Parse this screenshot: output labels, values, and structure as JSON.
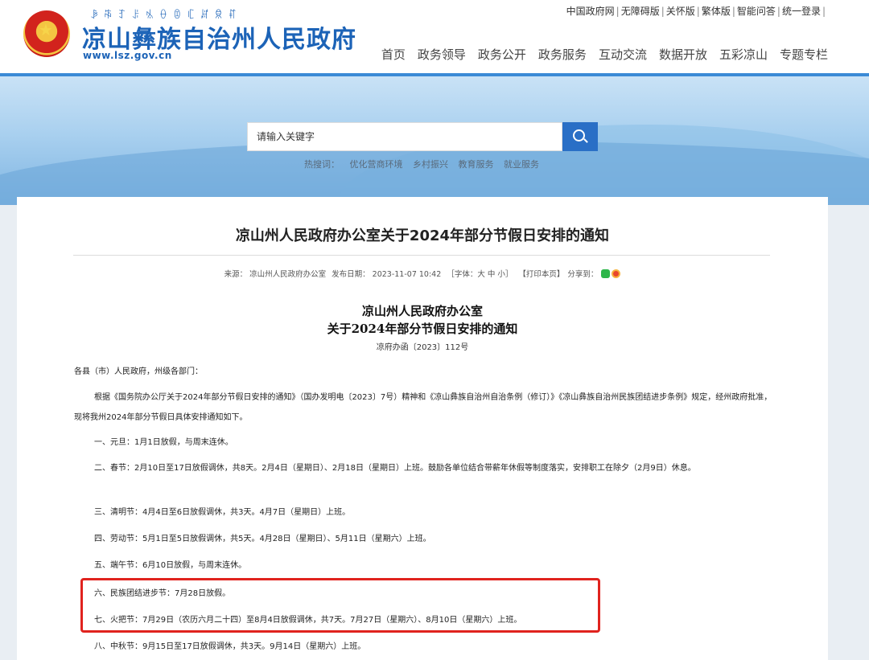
{
  "header": {
    "yi_script": "ꆃꎸꆈꌠꁱꂷꀧꏸꏦꌋꐥ",
    "site_title": "凉山彝族自治州人民政府",
    "site_url": "www.lsz.gov.cn",
    "top_links": [
      "中国政府网",
      "无障碍版",
      "关怀版",
      "繁体版",
      "智能问答",
      "统一登录"
    ],
    "nav": [
      "首页",
      "政务领导",
      "政务公开",
      "政务服务",
      "互动交流",
      "数据开放",
      "五彩凉山",
      "专题专栏"
    ]
  },
  "search": {
    "placeholder": "请输入关键字",
    "hotwords_label": "热搜词：",
    "hotwords": [
      "优化营商环境",
      "乡村振兴",
      "教育服务",
      "就业服务"
    ]
  },
  "article": {
    "title": "凉山州人民政府办公室关于2024年部分节假日安排的通知",
    "meta": {
      "source": "来源： 凉山州人民政府办公室",
      "date": "发布日期： 2023-11-07 10:42",
      "font_size": "［字体：大 中 小］",
      "print": "【打印本页】",
      "share": "分享到："
    },
    "doc_head1": "凉山州人民政府办公室",
    "doc_head2": "关于2024年部分节假日安排的通知",
    "doc_no": "凉府办函〔2023〕112号",
    "salutation": "各县（市）人民政府，州级各部门：",
    "intro": "根据《国务院办公厅关于2024年部分节假日安排的通知》（国办发明电〔2023〕7号）精神和《凉山彝族自治州自治条例（修订）》《凉山彝族自治州民族团结进步条例》规定，经州政府批准，现将我州2024年部分节假日具体安排通知如下。",
    "items": [
      "一、元旦：1月1日放假，与周末连休。",
      "二、春节：2月10日至17日放假调休，共8天。2月4日（星期日）、2月18日（星期日）上班。鼓励各单位结合带薪年休假等制度落实，安排职工在除夕（2月9日）休息。",
      "三、清明节：4月4日至6日放假调休，共3天。4月7日（星期日）上班。",
      "四、劳动节：5月1日至5日放假调休，共5天。4月28日（星期日）、5月11日（星期六）上班。",
      "五、端午节：6月10日放假，与周末连休。",
      "六、民族团结进步节：7月28日放假。",
      "七、火把节：7月29日（农历六月二十四）至8月4日放假调休，共7天。7月27日（星期六）、8月10日（星期六）上班。",
      "八、中秋节：9月15日至17日放假调休，共3天。9月14日（星期六）上班。"
    ]
  },
  "colors": {
    "brand_blue": "#1c63b7",
    "search_button": "#2a6fc6",
    "highlight_red": "#e0231e"
  }
}
